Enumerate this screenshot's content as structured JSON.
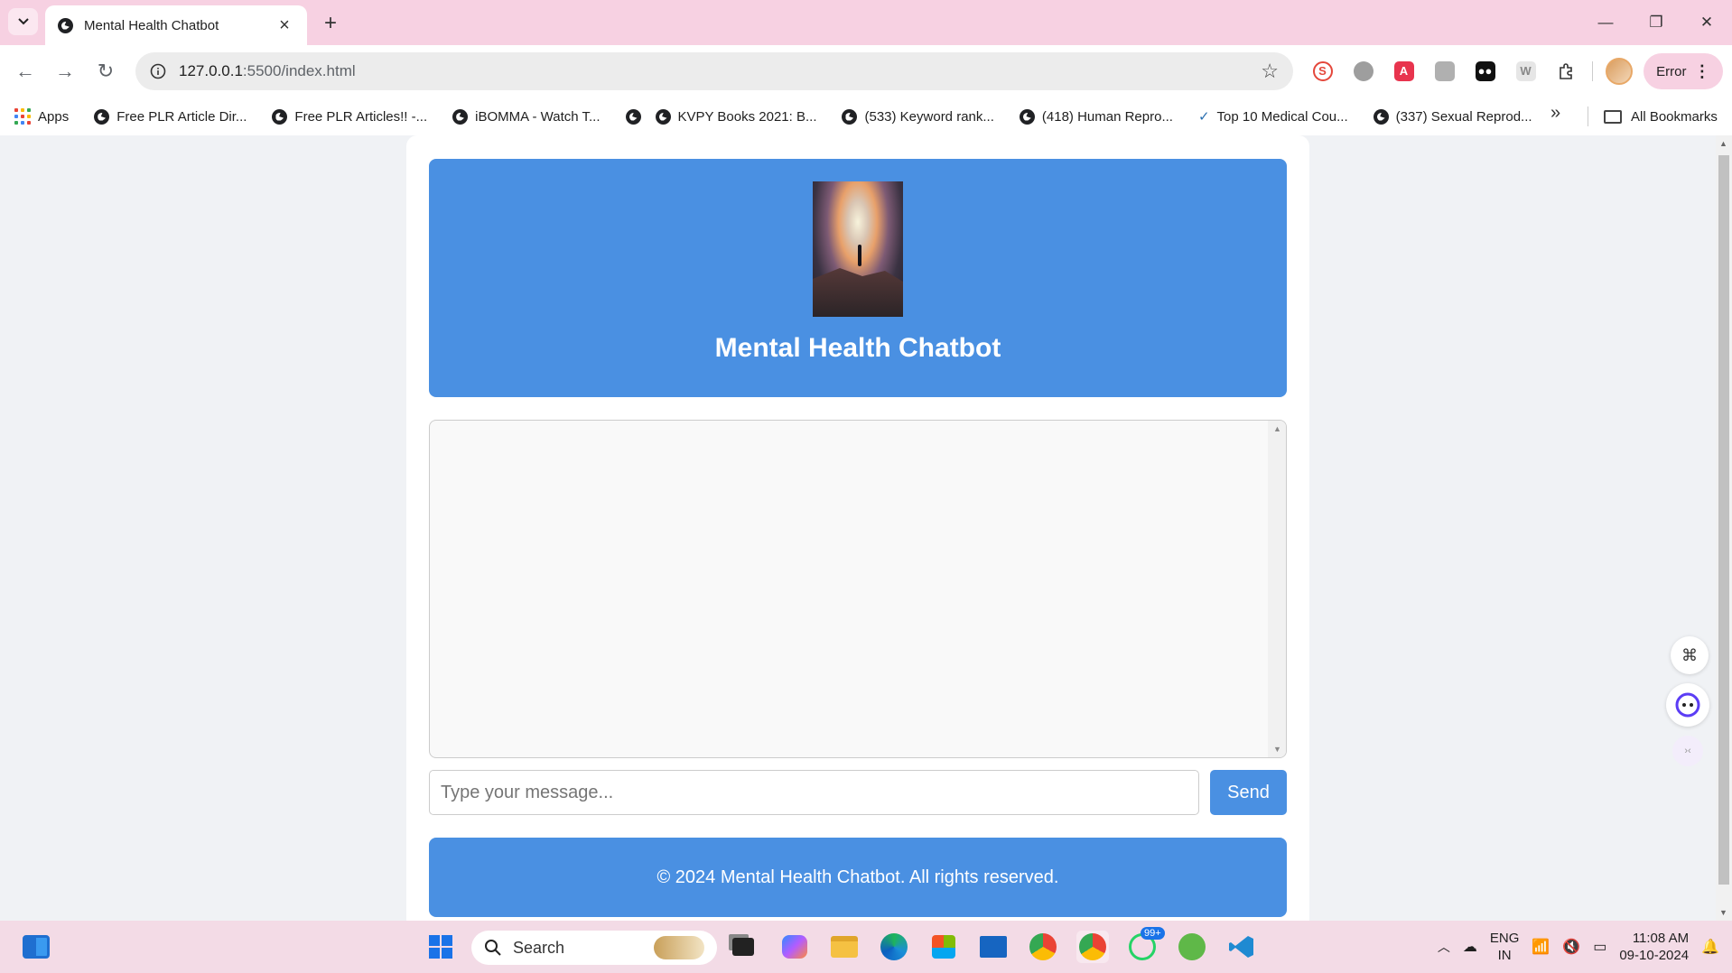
{
  "browser": {
    "tab_title": "Mental Health Chatbot",
    "url_host": "127.0.0.1",
    "url_rest": ":5500/index.html",
    "profile_status": "Error",
    "bookmarks": [
      {
        "label": "Apps"
      },
      {
        "label": "Free PLR Article Dir..."
      },
      {
        "label": "Free PLR Articles!! -..."
      },
      {
        "label": "iBOMMA - Watch T..."
      },
      {
        "label": ""
      },
      {
        "label": "KVPY Books 2021: B..."
      },
      {
        "label": "(533) Keyword rank..."
      },
      {
        "label": "(418) Human Repro..."
      },
      {
        "label": "Top 10 Medical Cou..."
      },
      {
        "label": "(337) Sexual Reprod..."
      }
    ],
    "all_bookmarks_label": "All Bookmarks"
  },
  "page": {
    "title": "Mental Health Chatbot",
    "input_placeholder": "Type your message...",
    "send_label": "Send",
    "footer_text": "© 2024 Mental Health Chatbot. All rights reserved."
  },
  "taskbar": {
    "search_label": "Search",
    "whatsapp_badge": "99+",
    "lang_line1": "ENG",
    "lang_line2": "IN",
    "time": "11:08 AM",
    "date": "09-10-2024"
  },
  "colors": {
    "accent": "#4a90e2",
    "tabbar": "#f7d1e2",
    "taskbar": "#f3dbe6"
  }
}
